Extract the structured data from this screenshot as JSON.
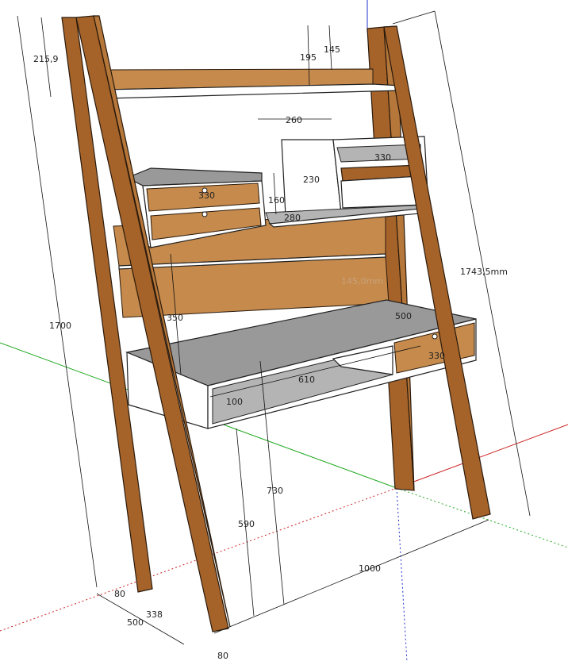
{
  "dimensions": {
    "top_shelf_drop": "215,9",
    "top_shelf_offset_195": "195",
    "top_shelf_offset_145": "145",
    "cubby_width": "260",
    "cubby_inner_width": "330",
    "cubby_height": "230",
    "drawer_width_top": "330",
    "drawer_height": "160",
    "shelf_depth": "280",
    "side_length": "1743,5mm",
    "total_height": "1700",
    "back_panel_height": "350",
    "back_panel_slot": "145,0mm",
    "desk_depth": "500",
    "desk_drawer_width": "330",
    "desk_width": "610",
    "desk_front_height": "100",
    "desk_height": "730",
    "leg_clearance": "590",
    "base_width": "1000",
    "leg_thickness_80a": "80",
    "leg_offset": "338",
    "base_depth": "500",
    "leg_thickness_80b": "80"
  },
  "colors": {
    "wood": "#a5632a",
    "panel_white": "#ffffff",
    "desk_grey": "#999999",
    "axis_red": "#cc2222",
    "axis_green": "#22aa22",
    "axis_blue": "#2233cc"
  }
}
